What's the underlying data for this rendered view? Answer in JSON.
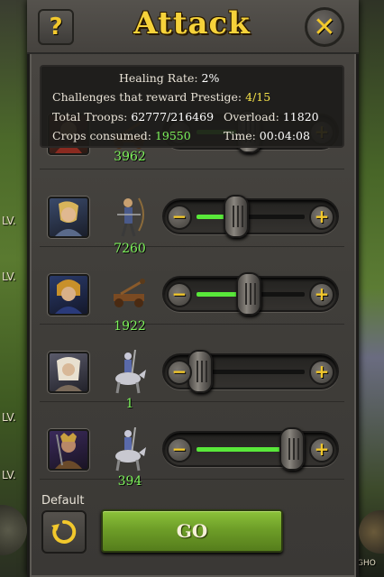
{
  "header": {
    "title": "Attack",
    "help_label": "?",
    "close_label": "✕"
  },
  "side": {
    "left_labels": [
      "LV.",
      "LV.",
      "LV.",
      "LV."
    ],
    "right_label": "GHO"
  },
  "info": {
    "healing_rate_label": "Healing Rate:",
    "healing_rate_value": "2%",
    "challenges_label": "Challenges that reward Prestige:",
    "challenges_value": "4/15",
    "total_troops_label": "Total Troops:",
    "total_troops_value": "62777/216469",
    "overload_label": "Overload:",
    "overload_value": "11820",
    "crops_label": "Crops consumed:",
    "crops_value": "19550",
    "time_label": "Time:",
    "time_value": "00:04:08"
  },
  "troops": [
    {
      "count": "3962",
      "unit_icon": "catapult-icon",
      "hero_icon": "hero-portrait-icon",
      "slider_fraction": 0.45
    },
    {
      "count": "7260",
      "unit_icon": "archer-icon",
      "hero_icon": "hero-portrait-icon",
      "slider_fraction": 0.33
    },
    {
      "count": "1922",
      "unit_icon": "catapult-icon",
      "hero_icon": "hero-portrait-icon",
      "slider_fraction": 0.45
    },
    {
      "count": "1",
      "unit_icon": "cavalry-icon",
      "hero_icon": "hero-portrait-icon",
      "slider_fraction": 0.0
    },
    {
      "count": "394",
      "unit_icon": "cavalry-icon",
      "hero_icon": "hero-portrait-icon",
      "slider_fraction": 0.85
    }
  ],
  "footer": {
    "default_label": "Default",
    "go_label": "GO"
  },
  "colors": {
    "accent_gold": "#f2c82c",
    "count_green": "#7cf25a",
    "go_green": "#6e9e28"
  }
}
